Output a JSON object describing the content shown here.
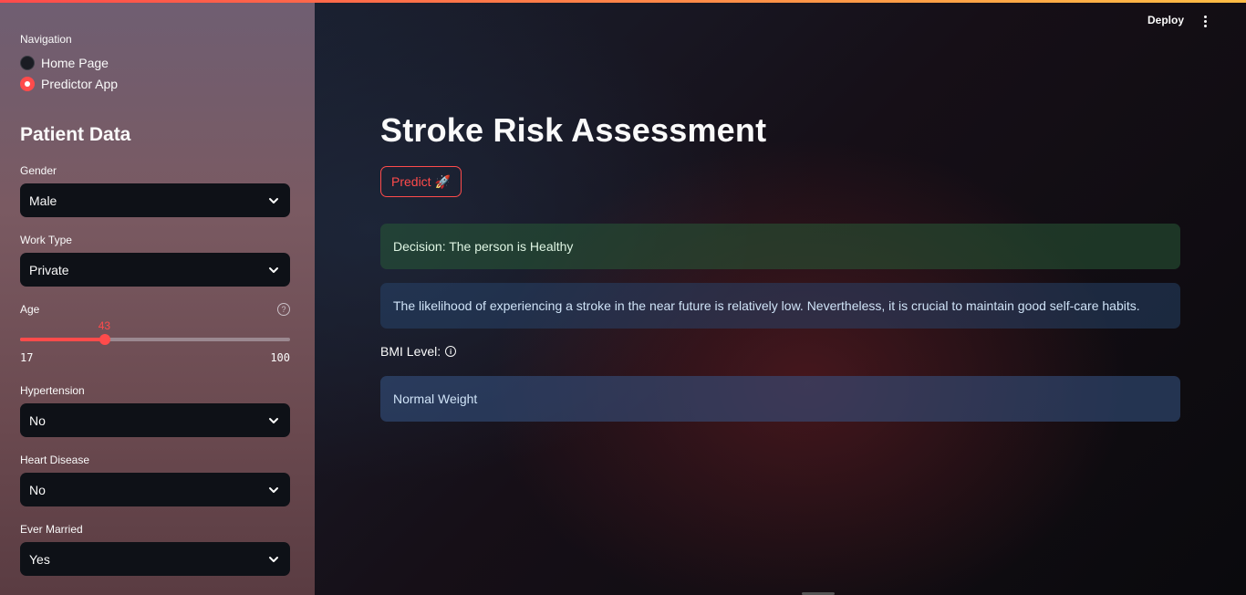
{
  "sidebar": {
    "navigation_label": "Navigation",
    "nav_options": [
      {
        "label": "Home Page",
        "selected": false
      },
      {
        "label": "Predictor App",
        "selected": true
      }
    ],
    "section_title": "Patient Data",
    "fields": {
      "gender": {
        "label": "Gender",
        "value": "Male"
      },
      "work_type": {
        "label": "Work Type",
        "value": "Private"
      },
      "age": {
        "label": "Age",
        "value": "43",
        "min": "17",
        "max": "100"
      },
      "hypertension": {
        "label": "Hypertension",
        "value": "No"
      },
      "heart_disease": {
        "label": "Heart Disease",
        "value": "No"
      },
      "ever_married": {
        "label": "Ever Married",
        "value": "Yes"
      }
    }
  },
  "header": {
    "deploy_label": "Deploy"
  },
  "main": {
    "title": "Stroke Risk Assessment",
    "predict_label": "Predict 🚀",
    "decision": "Decision: The person is Healthy",
    "likelihood": "The likelihood of experiencing a stroke in the near future is relatively low. Nevertheless, it is crucial to maintain good self-care habits.",
    "bmi_label": "BMI Level:",
    "bmi_value": "Normal Weight"
  },
  "colors": {
    "accent": "#ff4b4b",
    "success_bg": "#285a37",
    "info_bg": "#28466e"
  },
  "icons": [
    "chevron-down-icon",
    "help-icon",
    "info-icon",
    "more-vertical-icon",
    "rocket-icon"
  ]
}
